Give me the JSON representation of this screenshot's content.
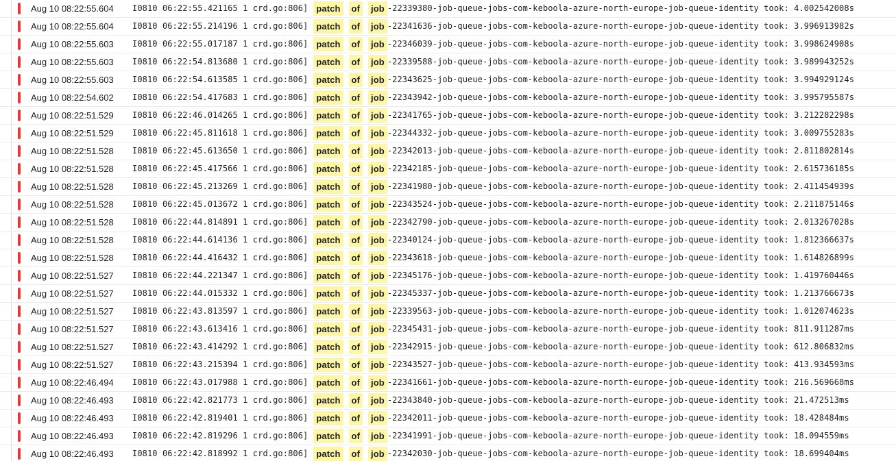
{
  "severity_color": "#e53935",
  "highlight_color": "#fef6a7",
  "entries": [
    {
      "ts": "Aug 10 08:22:55.604",
      "prefix": "I0810 06:22:55.421165 1 crd.go:806]",
      "kw1": "patch",
      "kw2": "of",
      "kw3": "job",
      "rest": "-22339380-job-queue-jobs-com-keboola-azure-north-europe-job-queue-identity took: 4.002542008s"
    },
    {
      "ts": "Aug 10 08:22:55.604",
      "prefix": "I0810 06:22:55.214196 1 crd.go:806]",
      "kw1": "patch",
      "kw2": "of",
      "kw3": "job",
      "rest": "-22341636-job-queue-jobs-com-keboola-azure-north-europe-job-queue-identity took: 3.996913982s"
    },
    {
      "ts": "Aug 10 08:22:55.603",
      "prefix": "I0810 06:22:55.017187 1 crd.go:806]",
      "kw1": "patch",
      "kw2": "of",
      "kw3": "job",
      "rest": "-22346039-job-queue-jobs-com-keboola-azure-north-europe-job-queue-identity took: 3.998624908s"
    },
    {
      "ts": "Aug 10 08:22:55.603",
      "prefix": "I0810 06:22:54.813680 1 crd.go:806]",
      "kw1": "patch",
      "kw2": "of",
      "kw3": "job",
      "rest": "-22339588-job-queue-jobs-com-keboola-azure-north-europe-job-queue-identity took: 3.989943252s"
    },
    {
      "ts": "Aug 10 08:22:55.603",
      "prefix": "I0810 06:22:54.613585 1 crd.go:806]",
      "kw1": "patch",
      "kw2": "of",
      "kw3": "job",
      "rest": "-22343625-job-queue-jobs-com-keboola-azure-north-europe-job-queue-identity took: 3.994929124s"
    },
    {
      "ts": "Aug 10 08:22:54.602",
      "prefix": "I0810 06:22:54.417683 1 crd.go:806]",
      "kw1": "patch",
      "kw2": "of",
      "kw3": "job",
      "rest": "-22343942-job-queue-jobs-com-keboola-azure-north-europe-job-queue-identity took: 3.995795587s"
    },
    {
      "ts": "Aug 10 08:22:51.529",
      "prefix": "I0810 06:22:46.014265 1 crd.go:806]",
      "kw1": "patch",
      "kw2": "of",
      "kw3": "job",
      "rest": "-22341765-job-queue-jobs-com-keboola-azure-north-europe-job-queue-identity took: 3.212282298s"
    },
    {
      "ts": "Aug 10 08:22:51.529",
      "prefix": "I0810 06:22:45.811618 1 crd.go:806]",
      "kw1": "patch",
      "kw2": "of",
      "kw3": "job",
      "rest": "-22344332-job-queue-jobs-com-keboola-azure-north-europe-job-queue-identity took: 3.009755283s"
    },
    {
      "ts": "Aug 10 08:22:51.528",
      "prefix": "I0810 06:22:45.613650 1 crd.go:806]",
      "kw1": "patch",
      "kw2": "of",
      "kw3": "job",
      "rest": "-22342013-job-queue-jobs-com-keboola-azure-north-europe-job-queue-identity took: 2.811802814s"
    },
    {
      "ts": "Aug 10 08:22:51.528",
      "prefix": "I0810 06:22:45.417566 1 crd.go:806]",
      "kw1": "patch",
      "kw2": "of",
      "kw3": "job",
      "rest": "-22342185-job-queue-jobs-com-keboola-azure-north-europe-job-queue-identity took: 2.615736185s"
    },
    {
      "ts": "Aug 10 08:22:51.528",
      "prefix": "I0810 06:22:45.213269 1 crd.go:806]",
      "kw1": "patch",
      "kw2": "of",
      "kw3": "job",
      "rest": "-22341980-job-queue-jobs-com-keboola-azure-north-europe-job-queue-identity took: 2.411454939s"
    },
    {
      "ts": "Aug 10 08:22:51.528",
      "prefix": "I0810 06:22:45.013672 1 crd.go:806]",
      "kw1": "patch",
      "kw2": "of",
      "kw3": "job",
      "rest": "-22343524-job-queue-jobs-com-keboola-azure-north-europe-job-queue-identity took: 2.211875146s"
    },
    {
      "ts": "Aug 10 08:22:51.528",
      "prefix": "I0810 06:22:44.814891 1 crd.go:806]",
      "kw1": "patch",
      "kw2": "of",
      "kw3": "job",
      "rest": "-22342790-job-queue-jobs-com-keboola-azure-north-europe-job-queue-identity took: 2.013267028s"
    },
    {
      "ts": "Aug 10 08:22:51.528",
      "prefix": "I0810 06:22:44.614136 1 crd.go:806]",
      "kw1": "patch",
      "kw2": "of",
      "kw3": "job",
      "rest": "-22340124-job-queue-jobs-com-keboola-azure-north-europe-job-queue-identity took: 1.812366637s"
    },
    {
      "ts": "Aug 10 08:22:51.528",
      "prefix": "I0810 06:22:44.416432 1 crd.go:806]",
      "kw1": "patch",
      "kw2": "of",
      "kw3": "job",
      "rest": "-22343618-job-queue-jobs-com-keboola-azure-north-europe-job-queue-identity took: 1.614826899s"
    },
    {
      "ts": "Aug 10 08:22:51.527",
      "prefix": "I0810 06:22:44.221347 1 crd.go:806]",
      "kw1": "patch",
      "kw2": "of",
      "kw3": "job",
      "rest": "-22345176-job-queue-jobs-com-keboola-azure-north-europe-job-queue-identity took: 1.419760446s"
    },
    {
      "ts": "Aug 10 08:22:51.527",
      "prefix": "I0810 06:22:44.015332 1 crd.go:806]",
      "kw1": "patch",
      "kw2": "of",
      "kw3": "job",
      "rest": "-22345337-job-queue-jobs-com-keboola-azure-north-europe-job-queue-identity took: 1.213766673s"
    },
    {
      "ts": "Aug 10 08:22:51.527",
      "prefix": "I0810 06:22:43.813597 1 crd.go:806]",
      "kw1": "patch",
      "kw2": "of",
      "kw3": "job",
      "rest": "-22339563-job-queue-jobs-com-keboola-azure-north-europe-job-queue-identity took: 1.012074623s"
    },
    {
      "ts": "Aug 10 08:22:51.527",
      "prefix": "I0810 06:22:43.613416 1 crd.go:806]",
      "kw1": "patch",
      "kw2": "of",
      "kw3": "job",
      "rest": "-22345431-job-queue-jobs-com-keboola-azure-north-europe-job-queue-identity took: 811.911287ms"
    },
    {
      "ts": "Aug 10 08:22:51.527",
      "prefix": "I0810 06:22:43.414292 1 crd.go:806]",
      "kw1": "patch",
      "kw2": "of",
      "kw3": "job",
      "rest": "-22342915-job-queue-jobs-com-keboola-azure-north-europe-job-queue-identity took: 612.806832ms"
    },
    {
      "ts": "Aug 10 08:22:51.527",
      "prefix": "I0810 06:22:43.215394 1 crd.go:806]",
      "kw1": "patch",
      "kw2": "of",
      "kw3": "job",
      "rest": "-22343527-job-queue-jobs-com-keboola-azure-north-europe-job-queue-identity took: 413.934593ms"
    },
    {
      "ts": "Aug 10 08:22:46.494",
      "prefix": "I0810 06:22:43.017988 1 crd.go:806]",
      "kw1": "patch",
      "kw2": "of",
      "kw3": "job",
      "rest": "-22341661-job-queue-jobs-com-keboola-azure-north-europe-job-queue-identity took: 216.569668ms"
    },
    {
      "ts": "Aug 10 08:22:46.493",
      "prefix": "I0810 06:22:42.821773 1 crd.go:806]",
      "kw1": "patch",
      "kw2": "of",
      "kw3": "job",
      "rest": "-22343840-job-queue-jobs-com-keboola-azure-north-europe-job-queue-identity took: 21.472513ms"
    },
    {
      "ts": "Aug 10 08:22:46.493",
      "prefix": "I0810 06:22:42.819401 1 crd.go:806]",
      "kw1": "patch",
      "kw2": "of",
      "kw3": "job",
      "rest": "-22342011-job-queue-jobs-com-keboola-azure-north-europe-job-queue-identity took: 18.428484ms"
    },
    {
      "ts": "Aug 10 08:22:46.493",
      "prefix": "I0810 06:22:42.819296 1 crd.go:806]",
      "kw1": "patch",
      "kw2": "of",
      "kw3": "job",
      "rest": "-22341991-job-queue-jobs-com-keboola-azure-north-europe-job-queue-identity took: 18.094559ms"
    },
    {
      "ts": "Aug 10 08:22:46.493",
      "prefix": "I0810 06:22:42.818992 1 crd.go:806]",
      "kw1": "patch",
      "kw2": "of",
      "kw3": "job",
      "rest": "-22342030-job-queue-jobs-com-keboola-azure-north-europe-job-queue-identity took: 18.699404ms"
    }
  ]
}
